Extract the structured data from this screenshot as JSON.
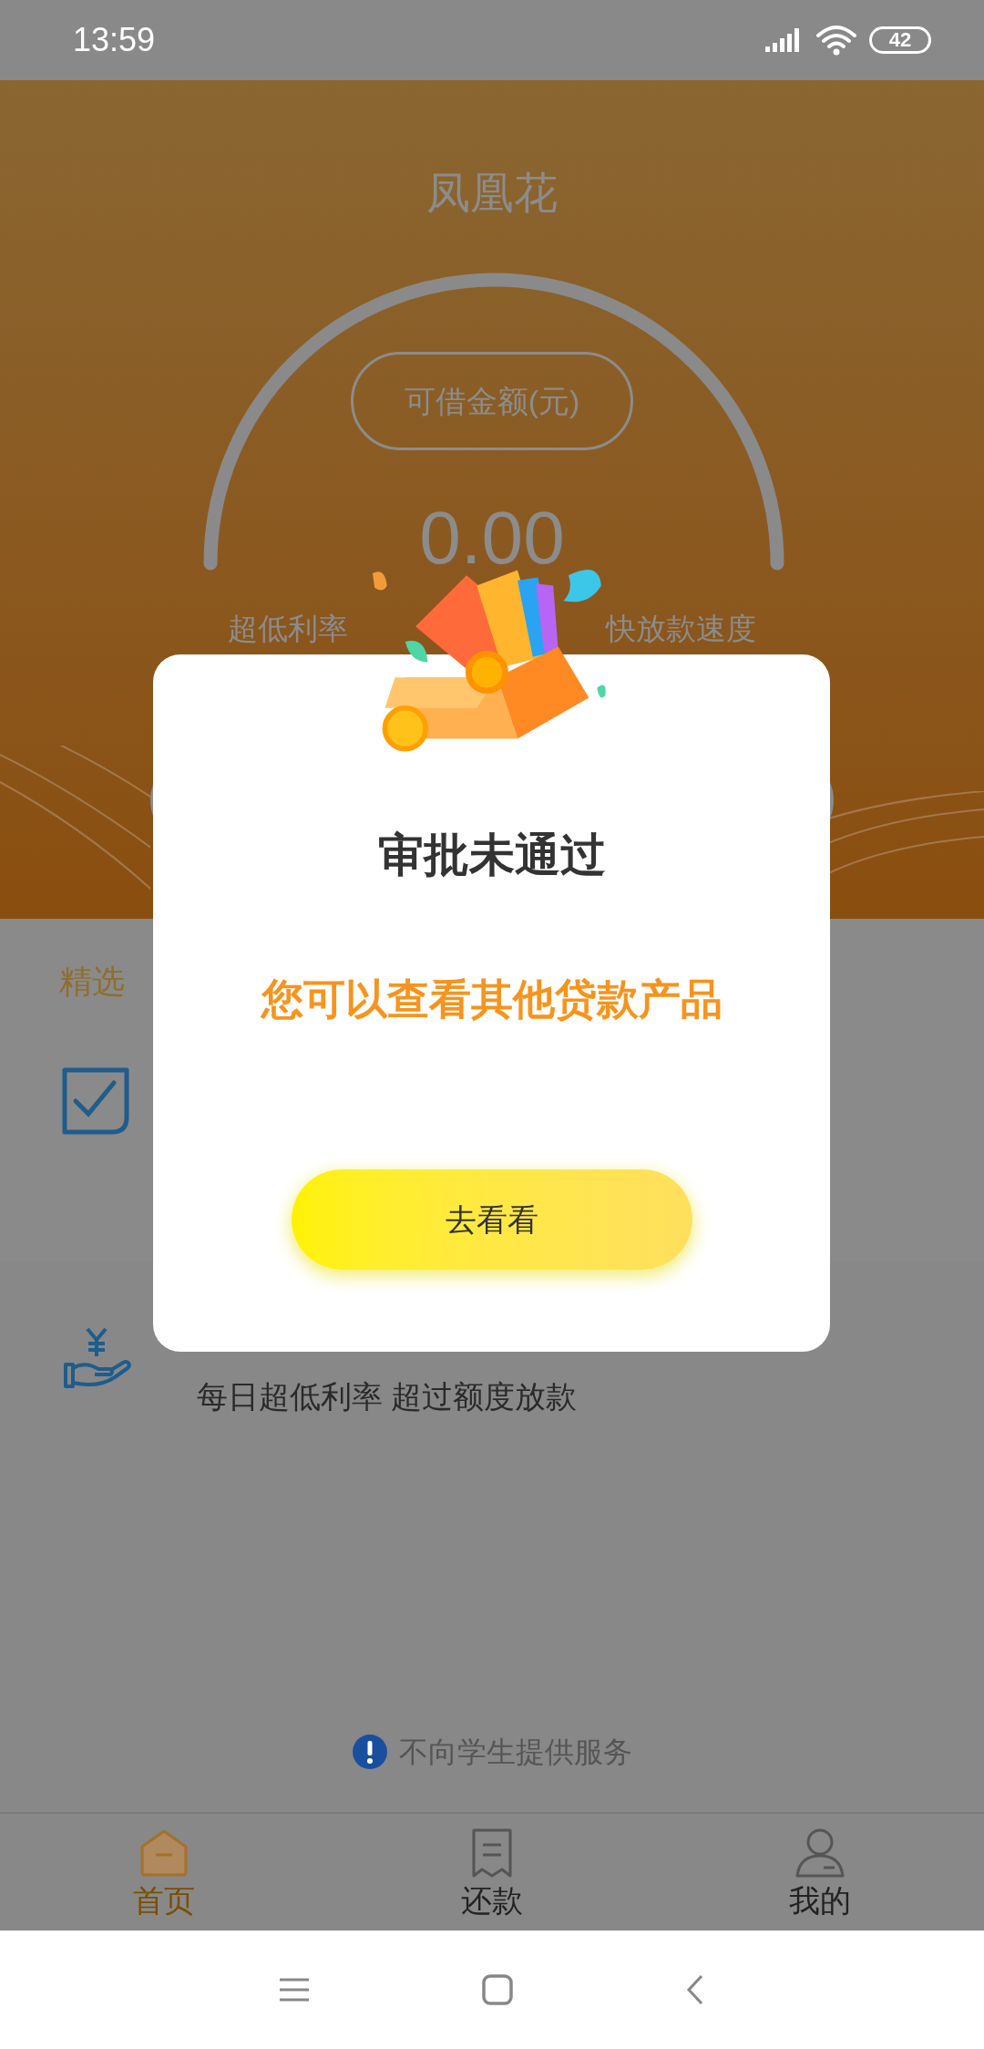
{
  "status_bar": {
    "time": "13:59",
    "battery": "42"
  },
  "header": {
    "title": "凤凰花",
    "amount_label": "可借金额(元)",
    "amount": "0.00",
    "tagline_left": "超低利率",
    "tagline_right": "快放款速度"
  },
  "section": {
    "title": "精选"
  },
  "features": [
    {
      "kind": "check"
    },
    {
      "kind": "money",
      "text": "每日超低利率 超过额度放款"
    }
  ],
  "notice": "不向学生提供服务",
  "tabs": [
    {
      "label": "首页",
      "kind": "home",
      "selected": true
    },
    {
      "label": "还款",
      "kind": "bill",
      "selected": false
    },
    {
      "label": "我的",
      "kind": "user",
      "selected": false
    }
  ],
  "dialog": {
    "title": "审批未通过",
    "message": "您可以查看其他贷款产品",
    "button": "去看看"
  }
}
